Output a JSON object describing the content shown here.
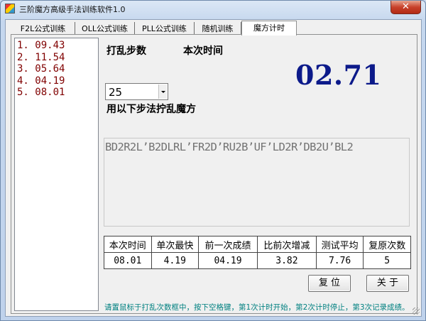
{
  "window": {
    "title": "三阶魔方高级手法训练软件1.0",
    "close_label": "✕"
  },
  "tabs": [
    {
      "label": "F2L公式训练"
    },
    {
      "label": "OLL公式训练"
    },
    {
      "label": "PLL公式训练"
    },
    {
      "label": "随机训练"
    },
    {
      "label": "魔方计时"
    }
  ],
  "times": [
    "1. 09.43",
    "2. 11.54",
    "3. 05.64",
    "4. 04.19",
    "5. 08.01"
  ],
  "labels": {
    "scramble_steps": "打乱步数",
    "current_time": "本次时间",
    "scramble_with": "用以下步法拧乱魔方"
  },
  "timer_value": "02.71",
  "steps_select": {
    "value": "25"
  },
  "scramble": "BD2R2L’B2DLRL’FR2D’RU2B’UF’LD2R’DB2U’BL2",
  "stats": {
    "headers": [
      "本次时间",
      "单次最快",
      "前一次成绩",
      "比前次增减",
      "测试平均",
      "复原次数"
    ],
    "values": [
      "08.01",
      "4.19",
      "04.19",
      "3.82",
      "7.76",
      "5"
    ]
  },
  "buttons": {
    "reset": "复 位",
    "about": "关 于"
  },
  "hint": "请置鼠标于打乱次数框中，按下空格键，第1次计时开始，第2次计时停止，第3次记录成绩。"
}
